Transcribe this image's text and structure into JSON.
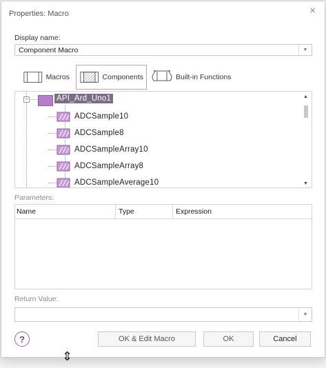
{
  "dialog": {
    "title": "Properties: Macro",
    "close_glyph": "×"
  },
  "display_name": {
    "label": "Display name:",
    "value": "Component Macro"
  },
  "tabs": [
    {
      "label": "Macros",
      "icon": "macro-icon",
      "active": false
    },
    {
      "label": "Components",
      "icon": "component-icon",
      "active": true
    },
    {
      "label": "Built-in Functions",
      "icon": "function-icon",
      "active": false
    }
  ],
  "tree": {
    "root": {
      "label": "API_Ard_Uno1",
      "collapse_glyph": "−"
    },
    "items": [
      "ADCSample10",
      "ADCSample8",
      "ADCSampleArray10",
      "ADCSampleArray8",
      "ADCSampleAverage10"
    ]
  },
  "parameters": {
    "label": "Parameters:",
    "columns": [
      "Name",
      "Type",
      "Expression"
    ]
  },
  "return_value": {
    "label": "Return Value:",
    "value": ""
  },
  "buttons": {
    "help": "?",
    "ok_edit": "OK & Edit Macro",
    "ok": "OK",
    "cancel": "Cancel"
  },
  "colors": {
    "accent": "#b57ec9",
    "selection": "#7b6d86",
    "tab_border": "#b9a0c8"
  }
}
